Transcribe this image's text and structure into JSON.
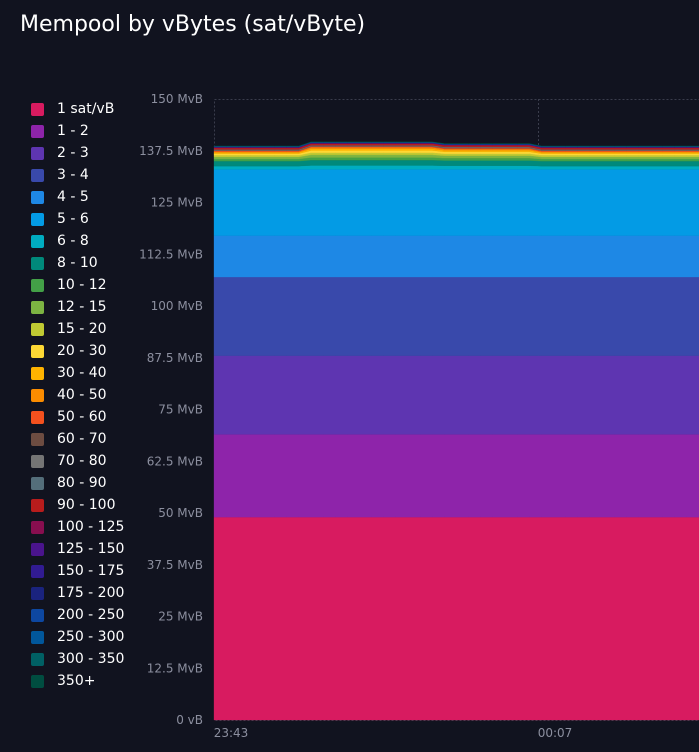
{
  "chart_data": {
    "type": "area",
    "title": "Mempool by vBytes (sat/vByte)",
    "unit": "MvB",
    "yticks": [
      "0 vB",
      "12.5 MvB",
      "25 MvB",
      "37.5 MvB",
      "50 MvB",
      "62.5 MvB",
      "75 MvB",
      "87.5 MvB",
      "100 MvB",
      "112.5 MvB",
      "125 MvB",
      "137.5 MvB",
      "150 MvB"
    ],
    "ylim": [
      0,
      150
    ],
    "xticks": [
      "23:43",
      "00:07"
    ],
    "grid": true,
    "legend_position": "left",
    "series": [
      {
        "name": "1 sat/vB",
        "color": "#d81b60",
        "value": 49
      },
      {
        "name": "1 - 2",
        "color": "#8e24aa",
        "value": 20
      },
      {
        "name": "2 - 3",
        "color": "#5e35b1",
        "value": 19
      },
      {
        "name": "3 - 4",
        "color": "#3949ab",
        "value": 19
      },
      {
        "name": "4 - 5",
        "color": "#1e88e5",
        "value": 10
      },
      {
        "name": "5 - 6",
        "color": "#039be5",
        "value": 16
      },
      {
        "name": "6 - 8",
        "color": "#00acc1",
        "value": 0.8
      },
      {
        "name": "8 - 10",
        "color": "#00897b",
        "value": 1.2
      },
      {
        "name": "10 - 12",
        "color": "#43a047",
        "value": 0.5
      },
      {
        "name": "12 - 15",
        "color": "#7cb342",
        "value": 0.5
      },
      {
        "name": "15 - 20",
        "color": "#c0ca33",
        "value": 0.4
      },
      {
        "name": "20 - 30",
        "color": "#fdd835",
        "value": 0.4
      },
      {
        "name": "30 - 40",
        "color": "#ffb300",
        "value": 0.3
      },
      {
        "name": "40 - 50",
        "color": "#fb8c00",
        "value": 0.2
      },
      {
        "name": "50 - 60",
        "color": "#f4511e",
        "value": 0.2
      },
      {
        "name": "60 - 70",
        "color": "#6d4c41",
        "value": 0.1
      },
      {
        "name": "70 - 80",
        "color": "#757575",
        "value": 0.1
      },
      {
        "name": "80 - 90",
        "color": "#546e7a",
        "value": 0.1
      },
      {
        "name": "90 - 100",
        "color": "#b71c1c",
        "value": 0.4
      },
      {
        "name": "100 - 125",
        "color": "#880e4f",
        "value": 0.1
      },
      {
        "name": "125 - 150",
        "color": "#4a148c",
        "value": 0.05
      },
      {
        "name": "150 - 175",
        "color": "#311b92",
        "value": 0.05
      },
      {
        "name": "175 - 200",
        "color": "#1a237e",
        "value": 0.05
      },
      {
        "name": "200 - 250",
        "color": "#0d47a1",
        "value": 0.05
      },
      {
        "name": "250 - 300",
        "color": "#01579b",
        "value": 0.05
      },
      {
        "name": "300 - 350",
        "color": "#006064",
        "value": 0.05
      },
      {
        "name": "350+",
        "color": "#004d40",
        "value": 0.05
      }
    ]
  }
}
